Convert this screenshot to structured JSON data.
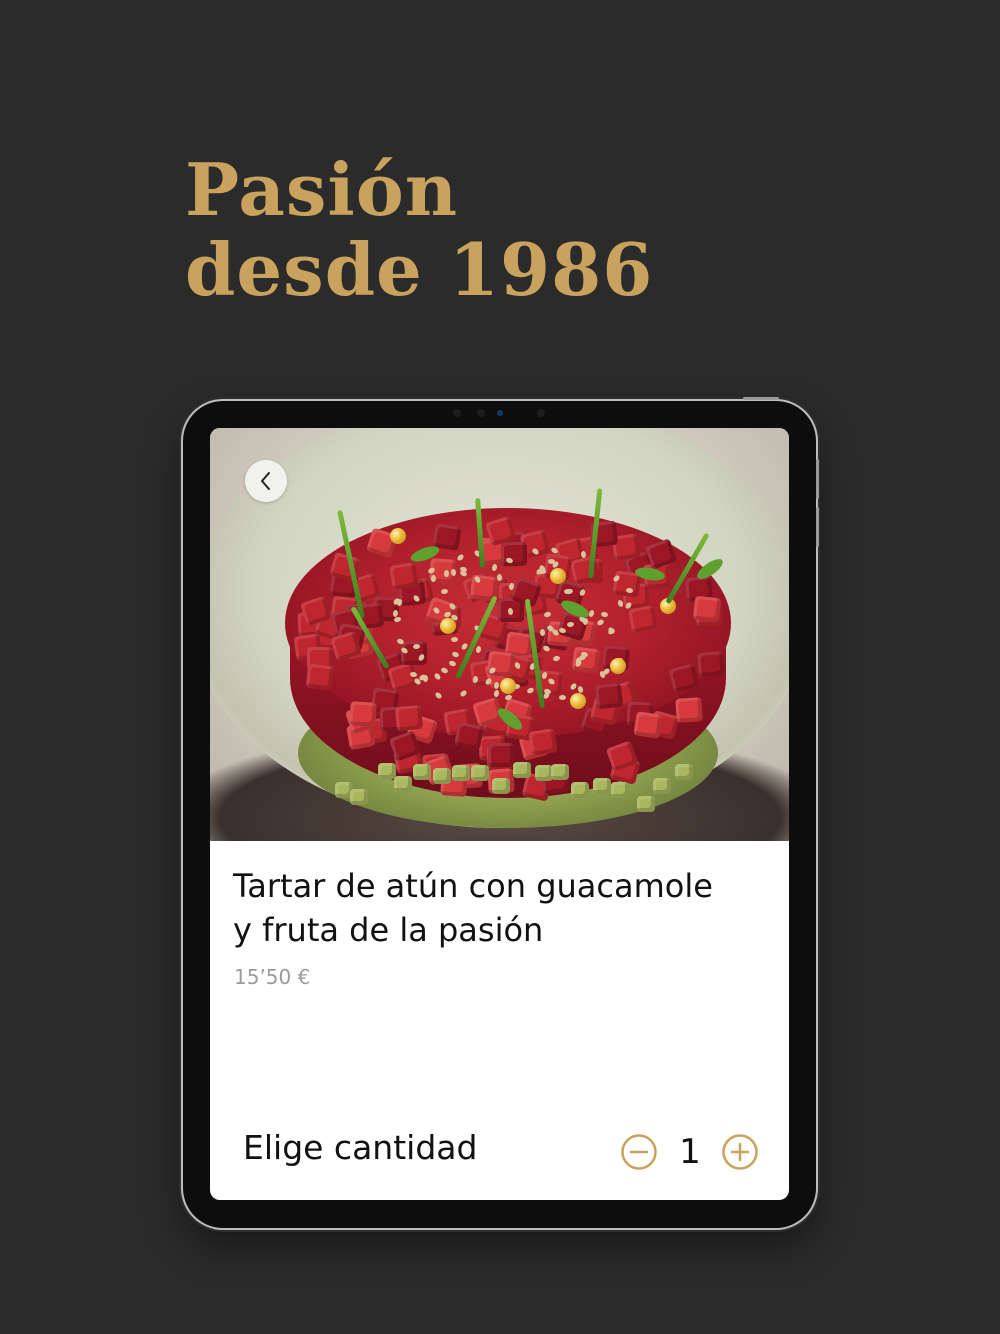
{
  "headline": {
    "line1": "Pasión",
    "line2": "desde 1986"
  },
  "colors": {
    "accent_gold": "#c9a35e",
    "background": "#2b2b2b",
    "card": "#ffffff"
  },
  "dish": {
    "title_line1": "Tartar de atún con guacamole",
    "title_line2": "y fruta de la pasión",
    "price": "15’50 €",
    "image_icon": "food-photo"
  },
  "quantity": {
    "label": "Elige cantidad",
    "value": "1",
    "decrement_icon": "minus-circle-icon",
    "increment_icon": "plus-circle-icon"
  },
  "navigation": {
    "back_icon": "chevron-left-icon"
  }
}
